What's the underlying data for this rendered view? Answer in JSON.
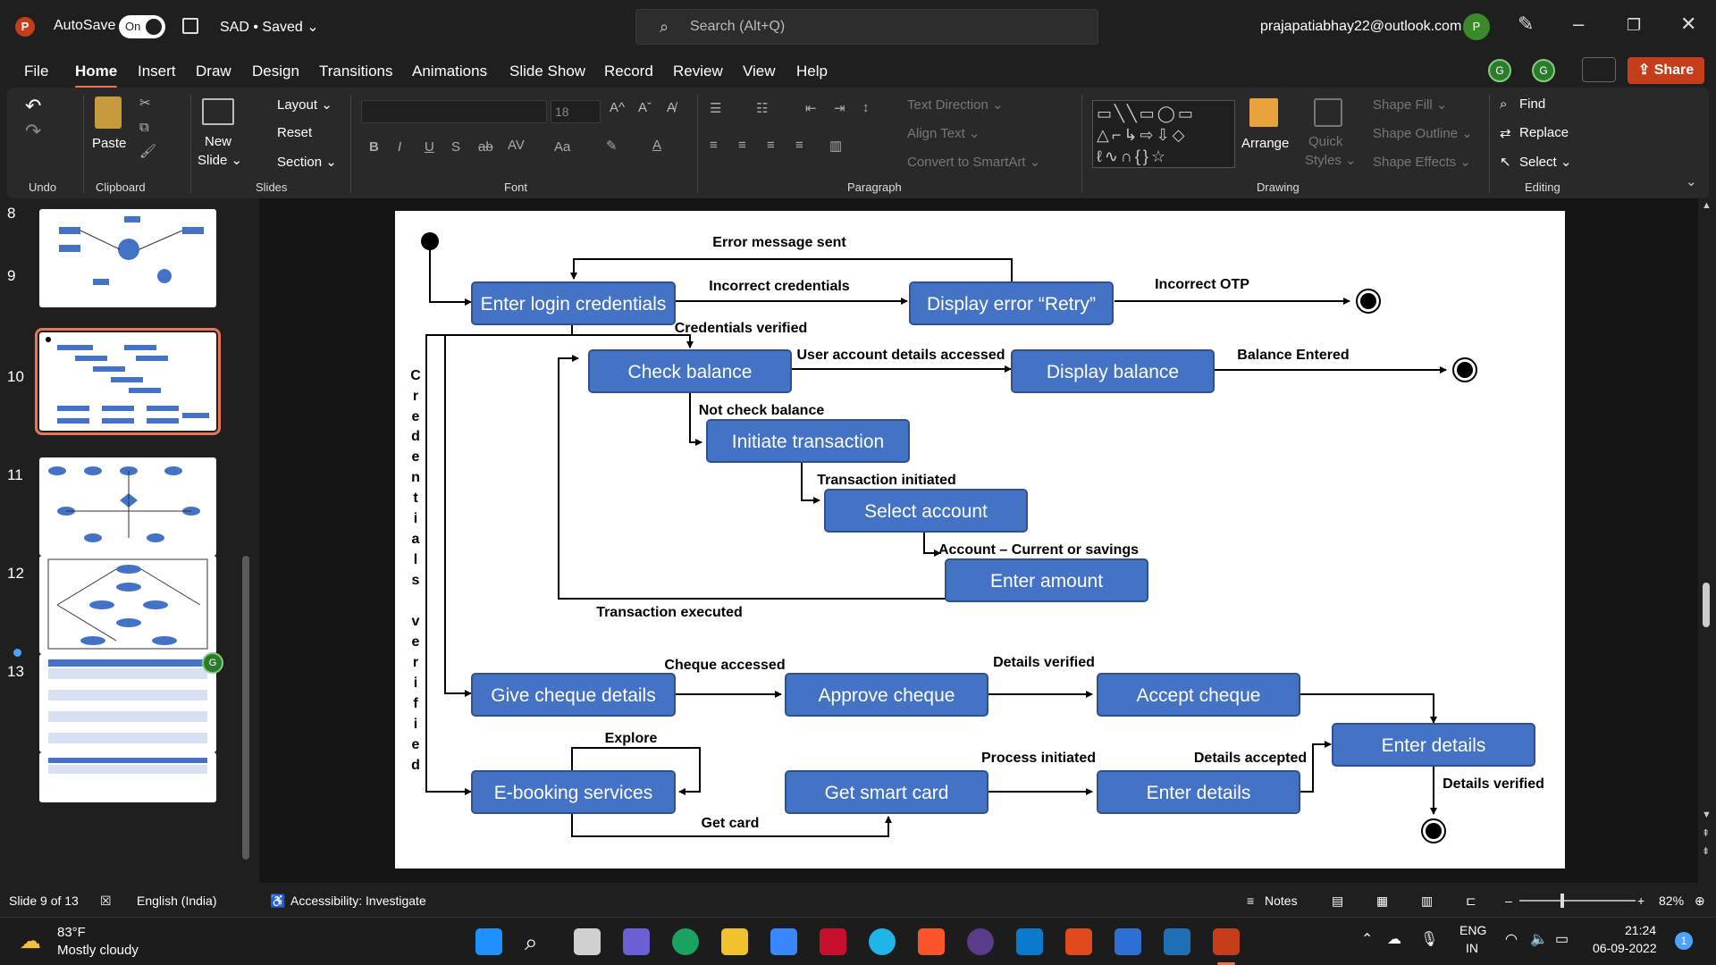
{
  "titlebar": {
    "autosave_label": "AutoSave",
    "toggle": "On",
    "doc": "SAD • Saved ⌄",
    "search_placeholder": "Search (Alt+Q)",
    "account": "prajapatiabhay22@outlook.com",
    "avatar": "P"
  },
  "menu": [
    "File",
    "Home",
    "Insert",
    "Draw",
    "Design",
    "Transitions",
    "Animations",
    "Slide Show",
    "Record",
    "Review",
    "View",
    "Help"
  ],
  "collab_avatars": [
    "G",
    "G"
  ],
  "share_label": "Share",
  "ribbon": {
    "groups": {
      "undo": "Undo",
      "clipboard": "Clipboard",
      "slides": "Slides",
      "font": "Font",
      "paragraph": "Paragraph",
      "drawing": "Drawing",
      "editing": "Editing"
    },
    "paste": "Paste",
    "new_slide": "New",
    "new_slide2": "Slide ⌄",
    "layout": "Layout ⌄",
    "reset": "Reset",
    "section": "Section ⌄",
    "font_size": "18",
    "font_buttons": [
      "B",
      "I",
      "U",
      "S",
      "ab",
      "AV",
      "Aa"
    ],
    "text_direction": "Text Direction ⌄",
    "align_text": "Align Text ⌄",
    "convert_smartart": "Convert to SmartArt ⌄",
    "arrange": "Arrange",
    "quick_styles": "Quick",
    "quick_styles2": "Styles ⌄",
    "shape_fill": "Shape Fill ⌄",
    "shape_outline": "Shape Outline ⌄",
    "shape_effects": "Shape Effects ⌄",
    "find": "Find",
    "replace": "Replace",
    "select": "Select ⌄"
  },
  "slides": {
    "numbers": [
      "8",
      "9",
      "10",
      "11",
      "12",
      "13"
    ],
    "thumb_avatar": "G"
  },
  "diagram": {
    "states": {
      "enter_login": "Enter login credentials",
      "display_error": "Display error “Retry”",
      "check_balance": "Check balance",
      "display_balance": "Display balance",
      "initiate_tx": "Initiate transaction",
      "select_account": "Select account",
      "enter_amount": "Enter amount",
      "give_cheque": "Give cheque details",
      "approve_cheque": "Approve cheque",
      "accept_cheque": "Accept cheque",
      "enter_details_right": "Enter details",
      "ebooking": "E-booking services",
      "smart_card": "Get smart card",
      "enter_details_mid": "Enter details"
    },
    "labels": {
      "error_msg": "Error message sent",
      "incorrect_cred": "Incorrect credentials",
      "incorrect_otp": "Incorrect OTP",
      "cred_verified": "Credentials verified",
      "user_acc": "User account details accessed",
      "balance_entered": "Balance Entered",
      "not_check": "Not check balance",
      "tx_initiated": "Transaction initiated",
      "acc_type": "Account – Current or savings",
      "tx_executed": "Transaction executed",
      "cheque_accessed": "Cheque accessed",
      "details_verified": "Details verified",
      "explore": "Explore",
      "process_initiated": "Process initiated",
      "details_accepted": "Details accepted",
      "details_verified2": "Details verified",
      "get_card": "Get card"
    },
    "vertical_text": [
      "C",
      "r",
      "e",
      "d",
      "e",
      "n",
      "t",
      "i",
      "a",
      "l",
      "s",
      "",
      "v",
      "e",
      "r",
      "i",
      "f",
      "i",
      "e",
      "d"
    ]
  },
  "status": {
    "slide": "Slide 9 of 13",
    "language": "English (India)",
    "accessibility": "Accessibility: Investigate",
    "notes": "Notes",
    "zoom": "82%"
  },
  "taskbar": {
    "temp": "83°F",
    "weather": "Mostly cloudy",
    "lang1": "ENG",
    "lang2": "IN",
    "time": "21:24",
    "date": "06-09-2022",
    "badge": "1"
  },
  "colors": {
    "accent": "#e8745a",
    "state_fill": "#4472c4",
    "state_border": "#2f528f",
    "share": "#c43e1c"
  }
}
